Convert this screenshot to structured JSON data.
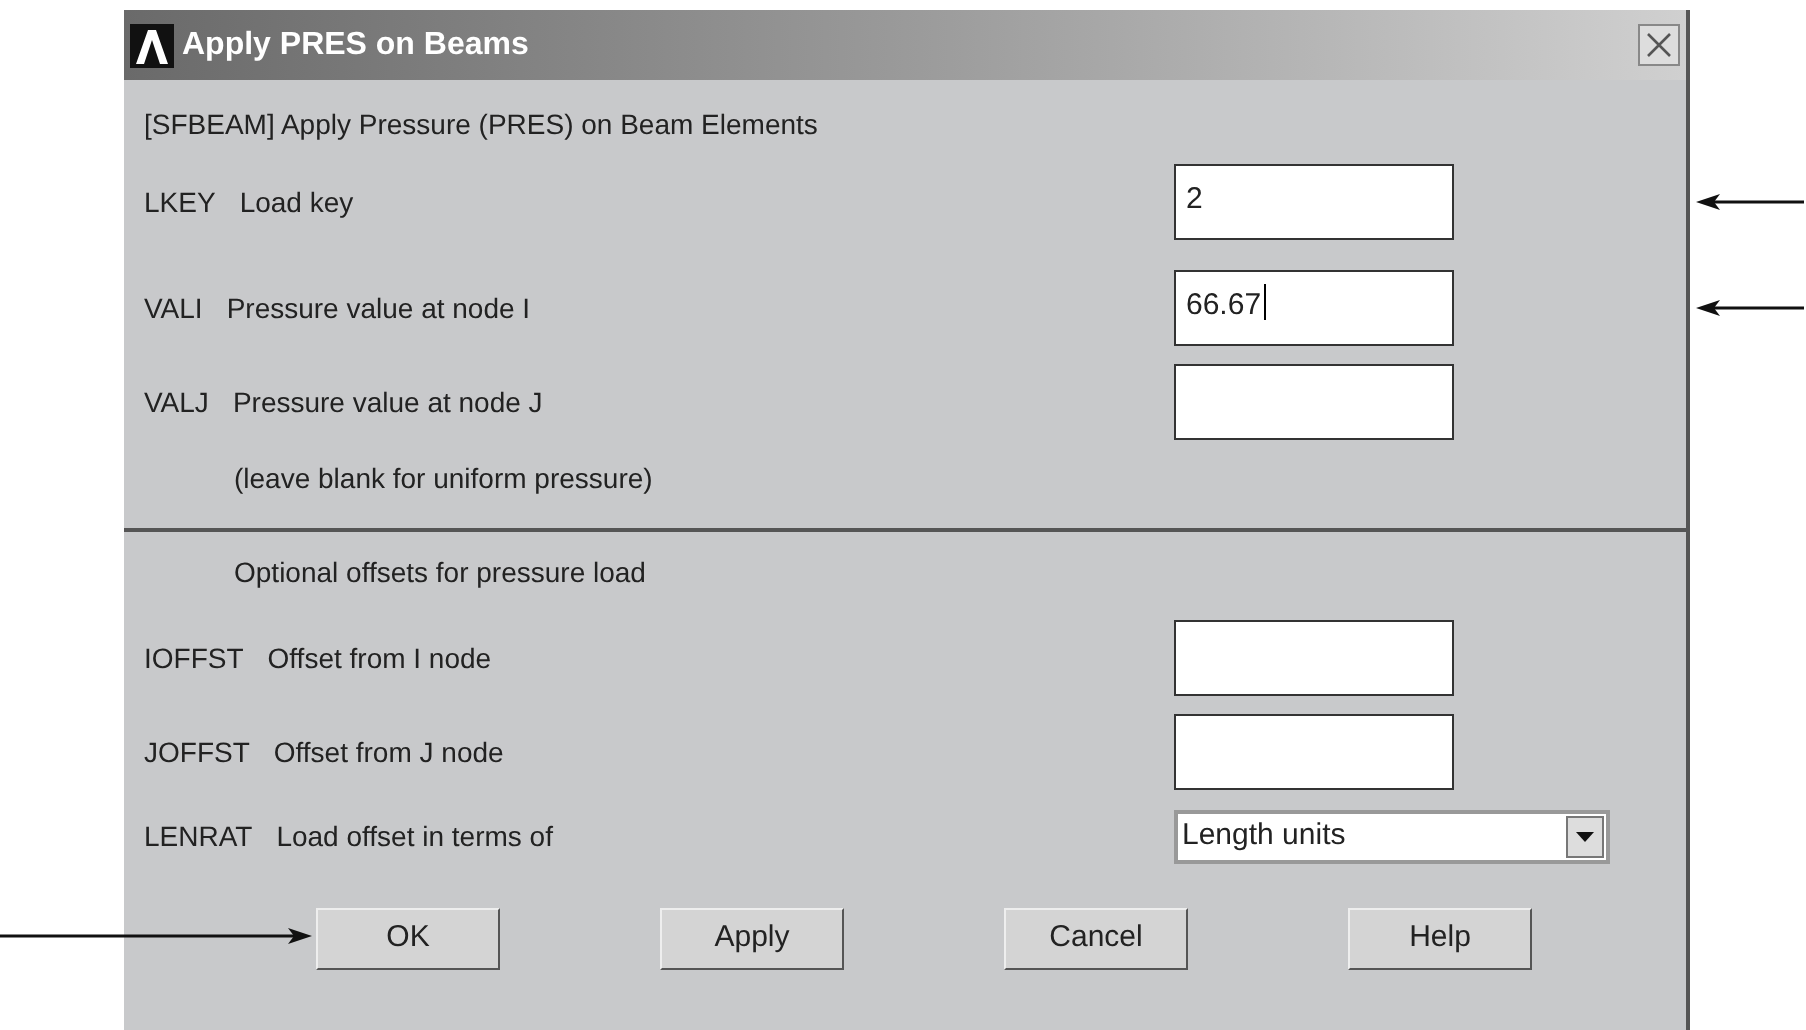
{
  "window": {
    "title": "Apply PRES on Beams"
  },
  "heading": "[SFBEAM]  Apply Pressure (PRES) on Beam Elements",
  "rows": [
    {
      "kind": "input",
      "code": "LKEY",
      "label": "Load key",
      "value": "2",
      "focused": false,
      "arrow": true
    },
    {
      "kind": "input",
      "code": "VALI",
      "label": "Pressure value at node I",
      "value": "66.67",
      "focused": true,
      "arrow": true
    },
    {
      "kind": "input",
      "code": "VALJ",
      "label": "Pressure value at node J",
      "focused": false,
      "arrow": false
    },
    {
      "kind": "note",
      "label": "(leave blank for uniform pressure)"
    },
    {
      "kind": "divider"
    },
    {
      "kind": "note",
      "label": "Optional offsets for pressure load"
    },
    {
      "kind": "input",
      "code": "IOFFST",
      "label": "Offset from I node",
      "focused": false,
      "arrow": false
    },
    {
      "kind": "input",
      "code": "JOFFST",
      "label": "Offset from J node",
      "focused": false,
      "arrow": false
    },
    {
      "kind": "select",
      "code": "LENRAT",
      "label": "Load offset in terms of",
      "value": "Length units"
    }
  ],
  "buttons": [
    {
      "label": "OK",
      "arrow": true
    },
    {
      "label": "Apply",
      "arrow": false
    },
    {
      "label": "Cancel",
      "arrow": false
    },
    {
      "label": "Help",
      "arrow": false
    }
  ]
}
